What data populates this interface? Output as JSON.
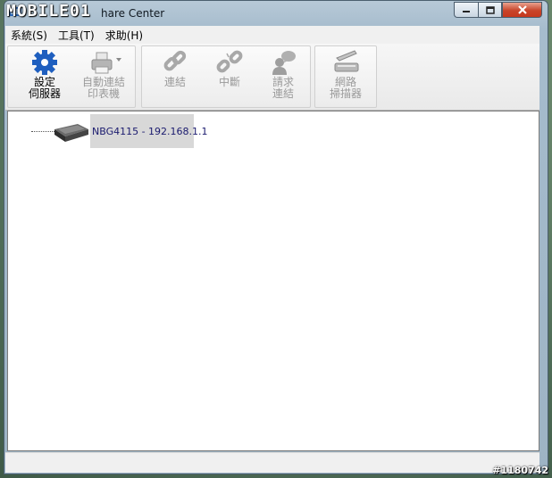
{
  "window": {
    "title": "hare Center"
  },
  "watermark": "MOBILE01",
  "menu": [
    {
      "label": "系統(S)"
    },
    {
      "label": "工具(T)"
    },
    {
      "label": "求助(H)"
    }
  ],
  "toolbar": {
    "buttons": [
      {
        "label": "設定\n伺服器",
        "icon": "gear-icon",
        "enabled": true
      },
      {
        "label": "自動連結\n印表機",
        "icon": "printer-icon",
        "enabled": false
      },
      {
        "label": "連結",
        "icon": "link-icon",
        "enabled": false
      },
      {
        "label": "中斷",
        "icon": "broken-link-icon",
        "enabled": false
      },
      {
        "label": "請求\n連結",
        "icon": "request-connect-icon",
        "enabled": false
      },
      {
        "label": "網路\n掃描器",
        "icon": "scanner-icon",
        "enabled": false
      }
    ]
  },
  "tree": {
    "devices": [
      {
        "label": "NBG4115 - 192.168.1.1",
        "icon": "router-icon"
      }
    ]
  },
  "footer": {
    "tag": "#1180742"
  },
  "colors": {
    "accent": "#1f5fbf",
    "selection": "#d8d8d8",
    "close_button": "#c6381d"
  }
}
